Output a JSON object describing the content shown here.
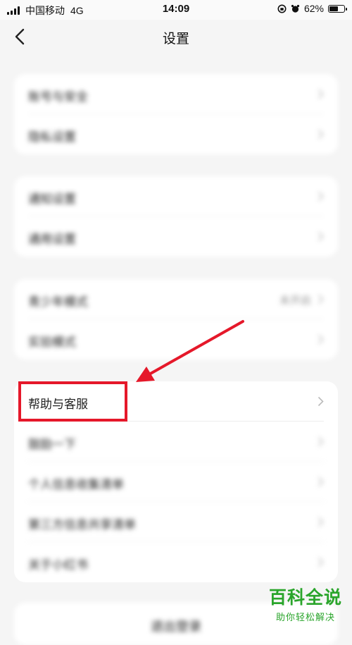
{
  "status_bar": {
    "carrier": "中国移动",
    "network": "4G",
    "time": "14:09",
    "battery_percent_label": "62%",
    "battery_level": 0.62
  },
  "nav": {
    "title": "设置",
    "back_icon": "chevron-left-icon"
  },
  "groups": [
    {
      "items": [
        {
          "label": "账号与安全"
        },
        {
          "label": "隐私设置"
        }
      ]
    },
    {
      "items": [
        {
          "label": "通知设置"
        },
        {
          "label": "通用设置"
        }
      ]
    },
    {
      "items": [
        {
          "label": "青少年模式",
          "value": "未开启"
        },
        {
          "label": "实验模式"
        }
      ]
    },
    {
      "items": [
        {
          "label": "帮助与客服"
        },
        {
          "label": "鼓励一下"
        },
        {
          "label": "个人信息收集清单"
        },
        {
          "label": "第三方信息共享清单"
        },
        {
          "label": "关于小红书"
        }
      ]
    }
  ],
  "bottom_button": {
    "label": "退出登录"
  },
  "annotation": {
    "color": "#e5182a"
  },
  "watermark": {
    "title": "百科全说",
    "subtitle": "助你轻松解决"
  },
  "colors": {
    "background": "#f5f5f5",
    "card": "#ffffff",
    "watermark": "#2aa52b"
  }
}
